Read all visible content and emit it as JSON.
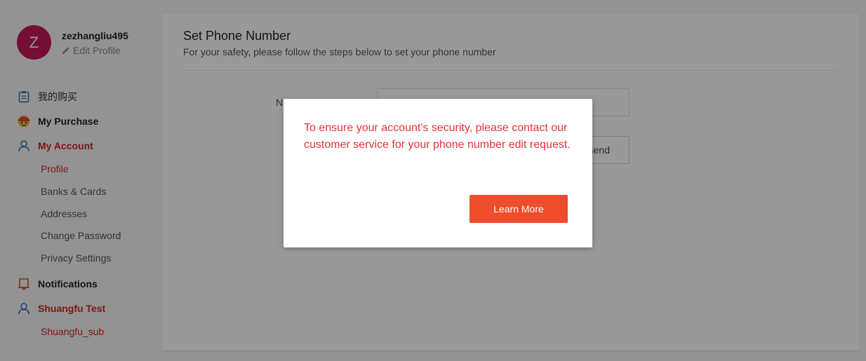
{
  "user": {
    "avatar_letter": "Z",
    "username": "zezhangliu495",
    "edit_profile_label": "Edit Profile"
  },
  "sidebar": {
    "items": [
      {
        "label": "我的购买",
        "icon": "clipboard-icon"
      },
      {
        "label": "My Purchase",
        "icon": "purchase-mascot-icon"
      },
      {
        "label": "My Account",
        "icon": "user-icon"
      },
      {
        "label": "Notifications",
        "icon": "bell-icon"
      },
      {
        "label": "Shuangfu Test",
        "icon": "user-icon"
      }
    ],
    "account_subitems": [
      "Profile",
      "Banks & Cards",
      "Addresses",
      "Change Password",
      "Privacy Settings"
    ],
    "shuangfu_subitems": [
      "Shuangfu_sub"
    ]
  },
  "main": {
    "title": "Set Phone Number",
    "subtitle": "For your safety, please follow the steps below to set your phone number",
    "form_label": "N",
    "send_label": "send"
  },
  "modal": {
    "message": "To ensure your account's security, please contact our customer service for your phone number edit request.",
    "button_label": "Learn More"
  },
  "colors": {
    "accent": "#ee4d2d",
    "active_red": "#d0261f",
    "avatar_bg": "#c2185b"
  }
}
